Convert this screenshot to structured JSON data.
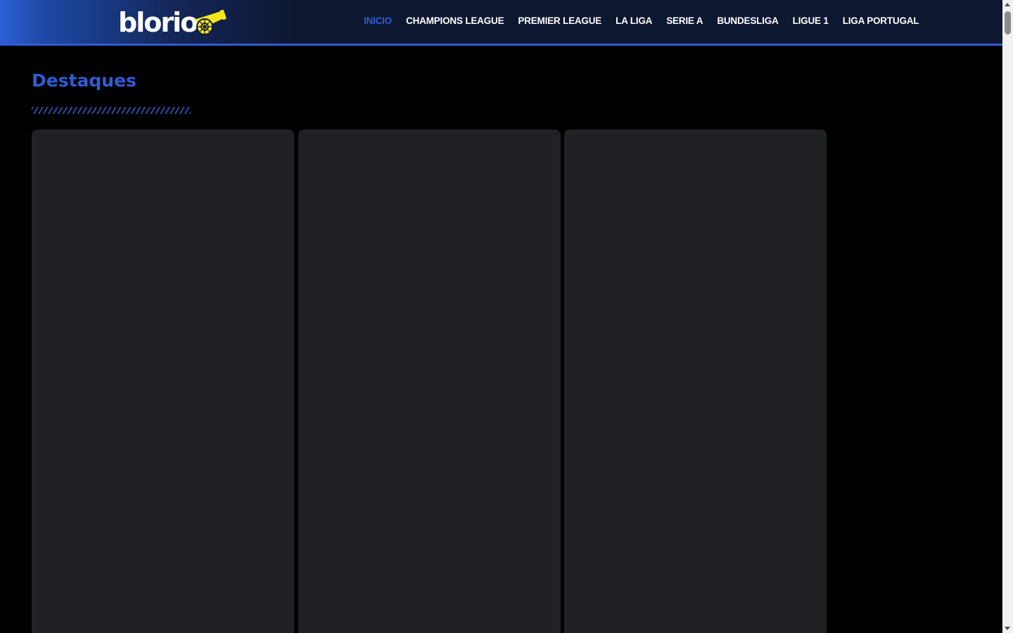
{
  "header": {
    "logo_text": "blorio",
    "nav": [
      {
        "label": "INICIO",
        "active": true
      },
      {
        "label": "CHAMPIONS LEAGUE",
        "active": false
      },
      {
        "label": "PREMIER LEAGUE",
        "active": false
      },
      {
        "label": "LA LIGA",
        "active": false
      },
      {
        "label": "SERIE A",
        "active": false
      },
      {
        "label": "BUNDESLIGA",
        "active": false
      },
      {
        "label": "LIGUE 1",
        "active": false
      },
      {
        "label": "LIGA PORTUGAL",
        "active": false
      }
    ]
  },
  "main": {
    "section_title": "Destaques",
    "cards_count": 3
  },
  "icons": {
    "logo_mark": "cannon-icon"
  },
  "colors": {
    "accent": "#2f5cd4",
    "header_bg": "#0d1730",
    "page_bg": "#000000",
    "card_bg": "#202124",
    "logo_cannon": "#f5e61e"
  }
}
